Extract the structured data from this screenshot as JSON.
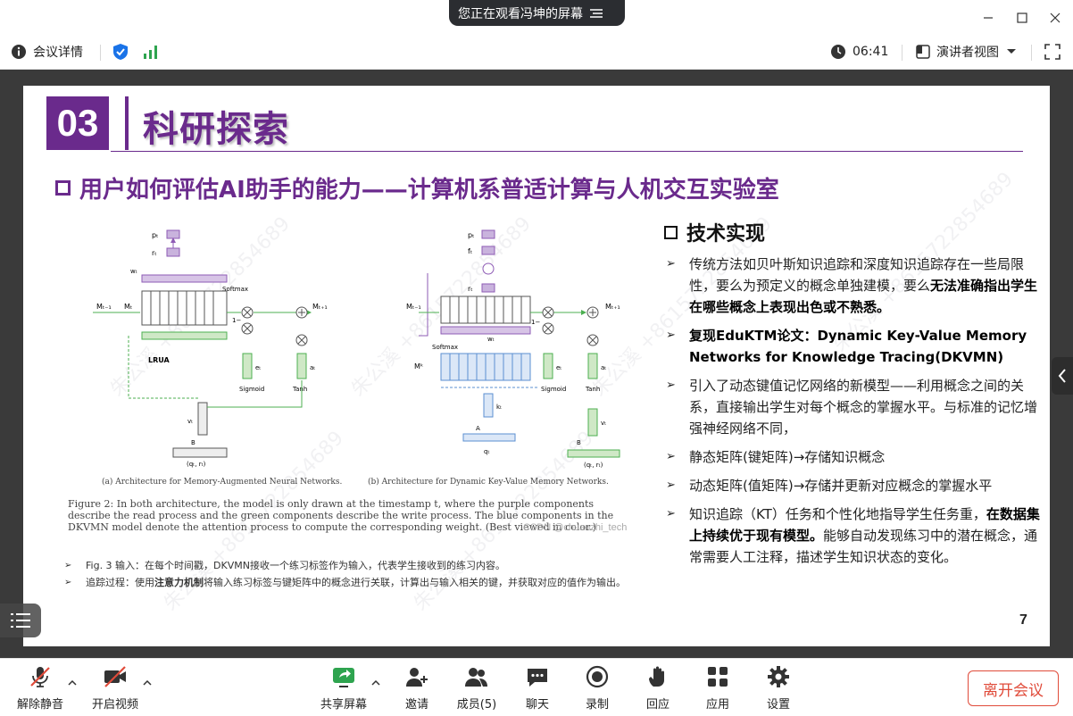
{
  "banner": {
    "text": "您正在观看冯坤的屏幕"
  },
  "toolbar": {
    "meeting_details": "会议详情",
    "timer": "06:41",
    "view_mode": "演讲者视图"
  },
  "slide": {
    "section_number": "03",
    "section_title": "科研探索",
    "subtitle": "用户如何评估AI助手的能力——计算机系普适计算与人机交互实验室",
    "watermark": "朱公溪 +8615722854689",
    "figure": {
      "caption_a": "(a) Architecture for Memory-Augmented Neural Networks.",
      "caption_b": "(b) Architecture for Dynamic Key-Value Memory Networks.",
      "caption_text": "Figure 2: In both architecture, the model is only drawn at the timestamp t, where the purple components describe the read process and the green components describe the write process. The blue components in the DKVMN model denote the attention process to compute the corresponding weight. (Best viewed in color.)",
      "csdn": "CSDN @chuanzhi_tech",
      "labels": {
        "p": "pₜ",
        "r": "rₜ",
        "w": "wₜ",
        "softmax": "Softmax",
        "lrua": "LRUA",
        "m_prev": "Mₜ₋₁",
        "m_cur": "Mₜ",
        "m_next": "Mₜ₊₁",
        "e": "eₜ",
        "a": "aₜ",
        "sigmoid": "Sigmoid",
        "tanh": "Tanh",
        "v": "vₜ",
        "b": "B",
        "q": "(qₜ, rₜ)",
        "one_minus": "1−",
        "f": "fₜ",
        "mk": "Mᵏ",
        "k": "kₜ",
        "a_emb": "A",
        "qt": "qₜ"
      }
    },
    "notes": [
      {
        "prefix": "Fig. 3 输入：在每个时间戳，DKVMN接收一个练习标签作为输入，代表学生接收到的练习内容。",
        "bold": "",
        "suffix": ""
      },
      {
        "prefix": "追踪过程：使用",
        "bold": "注意力机制",
        "suffix": "将输入练习标签与键矩阵中的概念进行关联，计算出与输入相关的键，并获取对应的值作为输出。"
      }
    ],
    "tech_title": "技术实现",
    "bullets": [
      {
        "parts": [
          {
            "t": "传统方法如贝叶斯知识追踪和深度知识追踪存在一些局限性，要么为预定义的概念单独建模，要么",
            "b": false
          },
          {
            "t": "无法准确指出学生在哪些概念上表现出色或不熟悉。",
            "b": true
          }
        ]
      },
      {
        "parts": [
          {
            "t": "复现EduKTM论文：Dynamic Key-Value Memory Networks for Knowledge Tracing(DKVMN)",
            "b": true
          }
        ]
      },
      {
        "parts": [
          {
            "t": "引入了动态键值记忆网络的新模型——利用概念之间的关系，直接输出学生对每个概念的掌握水平。与标准的记忆增强神经网络不同，",
            "b": false
          }
        ]
      },
      {
        "parts": [
          {
            "t": "静态矩阵(键矩阵)→存储知识概念",
            "b": false
          }
        ]
      },
      {
        "parts": [
          {
            "t": "动态矩阵(值矩阵)→存储并更新对应概念的掌握水平",
            "b": false
          }
        ]
      },
      {
        "parts": [
          {
            "t": "知识追踪（KT）任务和个性化地指导学生任务重，",
            "b": false
          },
          {
            "t": "在数据集上持续优于现有模型。",
            "b": true
          },
          {
            "t": "能够自动发现练习中的潜在概念，通常需要人工注释，描述学生知识状态的变化。",
            "b": false
          }
        ]
      }
    ],
    "page_number": "7"
  },
  "bottom": {
    "unmute": "解除静音",
    "start_video": "开启视频",
    "share_screen": "共享屏幕",
    "invite": "邀请",
    "members": "成员(5)",
    "chat": "聊天",
    "record": "录制",
    "reactions": "回应",
    "apps": "应用",
    "settings": "设置",
    "leave": "离开会议"
  },
  "colors": {
    "purple": "#6a2a8c",
    "green": "#2ea44f",
    "red": "#e04b3a",
    "blue": "#1a73e8"
  }
}
